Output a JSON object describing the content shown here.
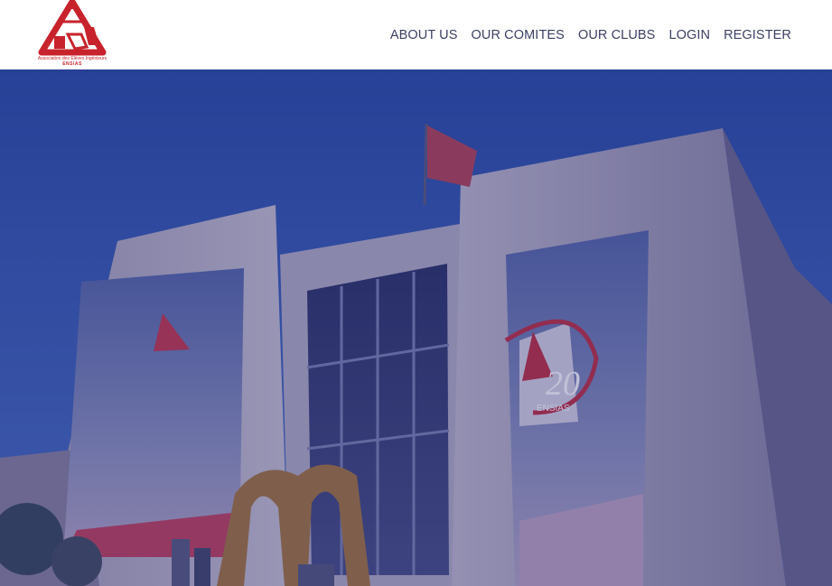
{
  "brand": {
    "logo_icon": "triangle-monogram-logo",
    "caption": "Association des Élèves Ingénieurs",
    "subtitle": "ENSIAS",
    "color": "#c8232c"
  },
  "nav": {
    "items": [
      {
        "label": "ABOUT US"
      },
      {
        "label": "OUR COMITES"
      },
      {
        "label": "OUR CLUBS"
      },
      {
        "label": "LOGIN"
      },
      {
        "label": "REGISTER"
      }
    ],
    "text_color": "#3b3f66"
  },
  "hero": {
    "image": "ensias-building-facade",
    "overlay_color": "#1c206e",
    "banner_badge": "20",
    "banner_badge_sub": "ENSIAS"
  }
}
